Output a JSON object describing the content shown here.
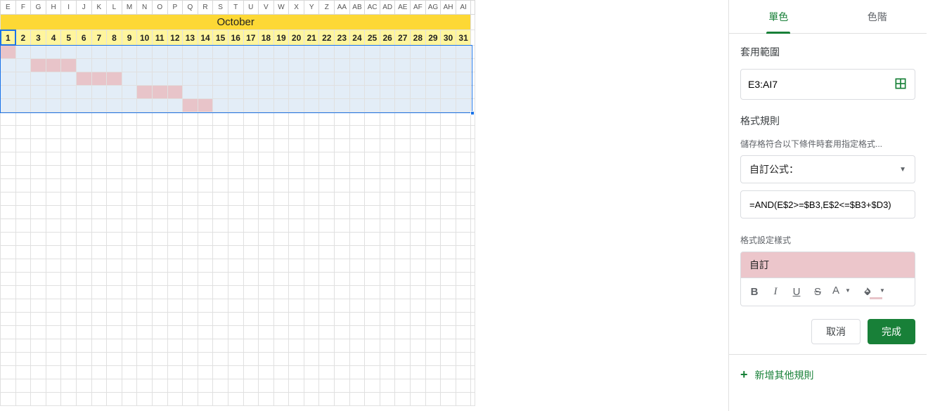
{
  "columns": [
    "E",
    "F",
    "G",
    "H",
    "I",
    "J",
    "K",
    "L",
    "M",
    "N",
    "O",
    "P",
    "Q",
    "R",
    "S",
    "T",
    "U",
    "V",
    "W",
    "X",
    "Y",
    "Z",
    "AA",
    "AB",
    "AC",
    "AD",
    "AE",
    "AF",
    "AG",
    "AH",
    "AI"
  ],
  "month_title": "October",
  "days": [
    "1",
    "2",
    "3",
    "4",
    "5",
    "6",
    "7",
    "8",
    "9",
    "10",
    "11",
    "12",
    "13",
    "14",
    "15",
    "16",
    "17",
    "18",
    "19",
    "20",
    "21",
    "22",
    "23",
    "24",
    "25",
    "26",
    "27",
    "28",
    "29",
    "30",
    "31"
  ],
  "gantt": [
    {
      "start": 0,
      "end": 0
    },
    {
      "start": 2,
      "end": 4
    },
    {
      "start": 5,
      "end": 7
    },
    {
      "start": 9,
      "end": 11
    },
    {
      "start": 12,
      "end": 13
    }
  ],
  "sidebar": {
    "tab_single": "單色",
    "tab_scale": "色階",
    "apply_range_label": "套用範圍",
    "range_value": "E3:AI7",
    "rules_label": "格式規則",
    "condition_hint": "儲存格符合以下條件時套用指定格式...",
    "condition_value": "自訂公式：",
    "formula_value": "=AND(E$2>=$B3,E$2<=$B3+$D3)",
    "style_label": "格式設定樣式",
    "style_preview": "自訂",
    "btn_cancel": "取消",
    "btn_done": "完成",
    "add_rule": "新增其他規則"
  }
}
